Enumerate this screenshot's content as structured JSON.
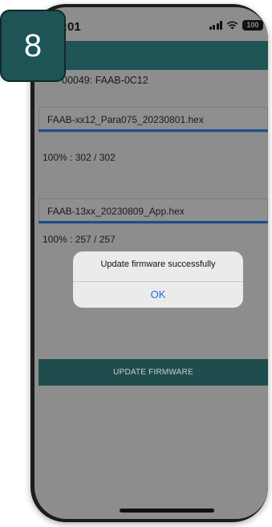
{
  "status": {
    "time": ":01",
    "battery": "100"
  },
  "device": {
    "label": "00049: FAAB-0C12"
  },
  "files": [
    {
      "name": "FAAB-xx12_Para075_20230801.hex",
      "progress_text": "100% : 302 / 302",
      "progress": 1.0
    },
    {
      "name": "FAAB-13xx_20230809_App.hex",
      "progress_text": "100% : 257 / 257",
      "progress": 1.0
    }
  ],
  "update_button": {
    "label": "UPDATE FIRMWARE"
  },
  "dialog": {
    "message": "Update firmware successfully",
    "ok_label": "OK"
  },
  "step_badge": {
    "number": "8"
  },
  "icons": [
    "signal-icon",
    "wifi-icon",
    "battery-icon"
  ],
  "colors": {
    "app_bar": "#1e5455",
    "progress": "#1b4e8f",
    "ok_button": "#1a6fd8"
  }
}
